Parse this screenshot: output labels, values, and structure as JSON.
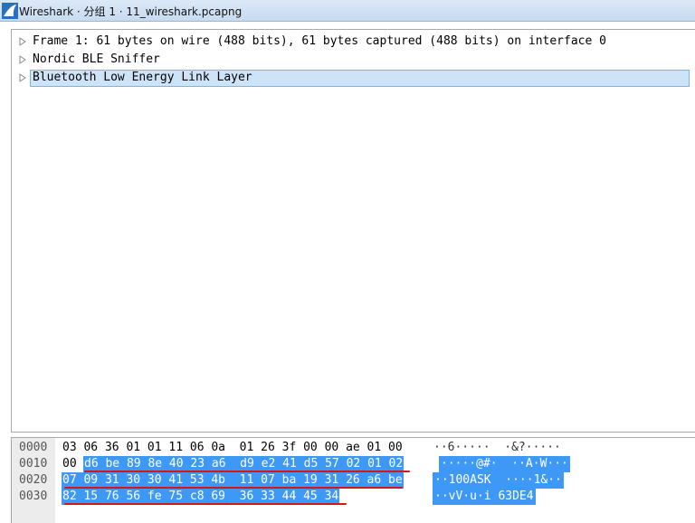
{
  "window": {
    "title": "Wireshark · 分组 1 · 11_wireshark.pcapng",
    "icon": "wireshark-fin-icon"
  },
  "tree": {
    "items": [
      {
        "label": "Frame 1: 61 bytes on wire (488 bits), 61 bytes captured (488 bits) on interface 0",
        "expanded": false,
        "selected": false
      },
      {
        "label": "Nordic BLE Sniffer",
        "expanded": false,
        "selected": false
      },
      {
        "label": "Bluetooth Low Energy Link Layer",
        "expanded": false,
        "selected": true
      }
    ],
    "expander_icon": "triangle-right-icon"
  },
  "hex": {
    "rows": [
      {
        "offset": "0000",
        "bytes_plain": "03 06 36 01 01 11 06 0a  01 26 3f 00 00 ae 01 00",
        "bytes_selected": "",
        "ascii_plain": "··6·····  ·&?·····",
        "ascii_selected": ""
      },
      {
        "offset": "0010",
        "bytes_plain": "00",
        "bytes_selected": "d6 be 89 8e 40 23 a6  d9 e2 41 d5 57 02 01 02",
        "ascii_plain": "",
        "ascii_selected": "·····@#·  ··A·W···"
      },
      {
        "offset": "0020",
        "bytes_plain": "",
        "bytes_selected": "07 09 31 30 30 41 53 4b  11 07 ba 19 31 26 a6 be",
        "ascii_plain": "",
        "ascii_selected": "··100ASK  ····1&··"
      },
      {
        "offset": "0030",
        "bytes_plain": "",
        "bytes_selected": "82 15 76 56 fe 75 c8 69  36 33 44 45 34",
        "ascii_plain": "",
        "ascii_selected": "··vV·u·i 63DE4"
      }
    ],
    "selection_color": "#3d99f5",
    "annotation_color": "#d01818"
  }
}
